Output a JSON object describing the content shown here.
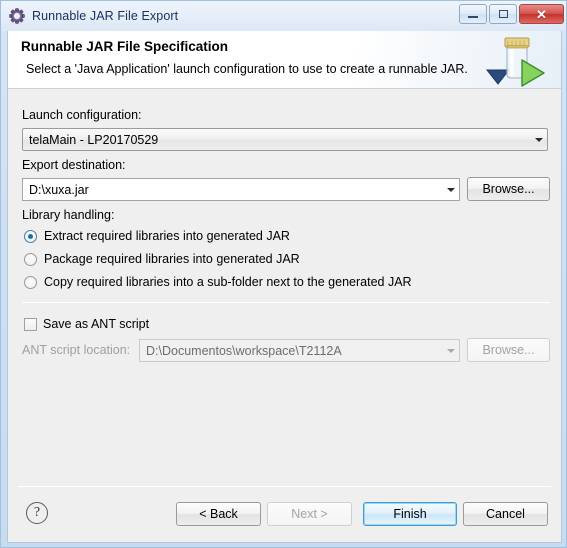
{
  "window": {
    "title": "Runnable JAR File Export",
    "icon": "export-gear-icon",
    "controls": {
      "minimize": "minimize-icon",
      "maximize": "maximize-icon",
      "close": "✕"
    }
  },
  "header": {
    "title": "Runnable JAR File Specification",
    "description": "Select a 'Java Application' launch configuration to use to create a runnable JAR.",
    "icon": "runnable-jar-icon"
  },
  "form": {
    "launch_configuration": {
      "label": "Launch configuration:",
      "value": "telaMain - LP20170529",
      "placeholder": ""
    },
    "export_destination": {
      "label": "Export destination:",
      "value": "D:\\xuxa.jar",
      "placeholder": "",
      "browse_label": "Browse..."
    },
    "library_handling": {
      "label": "Library handling:",
      "options": [
        {
          "label": "Extract required libraries into generated JAR",
          "selected": true
        },
        {
          "label": "Package required libraries into generated JAR",
          "selected": false
        },
        {
          "label": "Copy required libraries into a sub-folder next to the generated JAR",
          "selected": false
        }
      ]
    },
    "ant_script": {
      "checkbox_label": "Save as ANT script",
      "checked": false,
      "location_label": "ANT script location:",
      "location_value": "D:\\Documentos\\workspace\\T2112A",
      "browse_label": "Browse...",
      "enabled": false
    }
  },
  "footer": {
    "help_label": "?",
    "buttons": [
      {
        "label": "< Back",
        "state": "enabled"
      },
      {
        "label": "Next >",
        "state": "disabled"
      },
      {
        "label": "Finish",
        "state": "default"
      },
      {
        "label": "Cancel",
        "state": "enabled"
      }
    ]
  },
  "colors": {
    "accent": "#1d6ea8",
    "default_button_border": "#3c9ed6",
    "dialog_background": "#efefef",
    "title_text": "#15325b",
    "close_button": "#c2332c"
  }
}
